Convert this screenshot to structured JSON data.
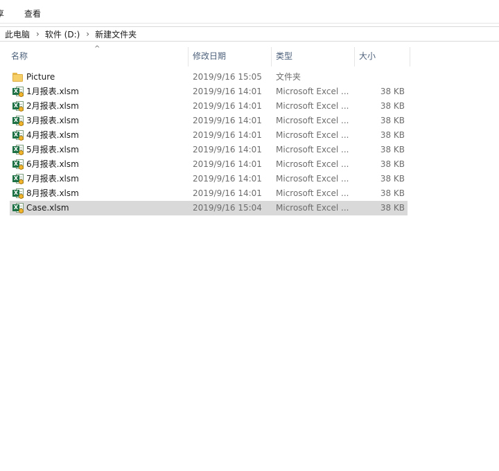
{
  "ribbon": {
    "tabs": [
      "享",
      "查看"
    ]
  },
  "address": {
    "crumbs": [
      "此电脑",
      "软件 (D:)",
      "新建文件夹"
    ],
    "separator": "›"
  },
  "columns": {
    "name": "名称",
    "date": "修改日期",
    "type": "类型",
    "size": "大小",
    "sort_indicator": "^"
  },
  "files": [
    {
      "icon": "folder-icon",
      "name": "Picture",
      "date": "2019/9/16 15:05",
      "type": "文件夹",
      "size": ""
    },
    {
      "icon": "excel-macro-icon",
      "name": "1月报表.xlsm",
      "date": "2019/9/16 14:01",
      "type": "Microsoft Excel ...",
      "size": "38 KB"
    },
    {
      "icon": "excel-macro-icon",
      "name": "2月报表.xlsm",
      "date": "2019/9/16 14:01",
      "type": "Microsoft Excel ...",
      "size": "38 KB"
    },
    {
      "icon": "excel-macro-icon",
      "name": "3月报表.xlsm",
      "date": "2019/9/16 14:01",
      "type": "Microsoft Excel ...",
      "size": "38 KB"
    },
    {
      "icon": "excel-macro-icon",
      "name": "4月报表.xlsm",
      "date": "2019/9/16 14:01",
      "type": "Microsoft Excel ...",
      "size": "38 KB"
    },
    {
      "icon": "excel-macro-icon",
      "name": "5月报表.xlsm",
      "date": "2019/9/16 14:01",
      "type": "Microsoft Excel ...",
      "size": "38 KB"
    },
    {
      "icon": "excel-macro-icon",
      "name": "6月报表.xlsm",
      "date": "2019/9/16 14:01",
      "type": "Microsoft Excel ...",
      "size": "38 KB"
    },
    {
      "icon": "excel-macro-icon",
      "name": "7月报表.xlsm",
      "date": "2019/9/16 14:01",
      "type": "Microsoft Excel ...",
      "size": "38 KB"
    },
    {
      "icon": "excel-macro-icon",
      "name": "8月报表.xlsm",
      "date": "2019/9/16 14:01",
      "type": "Microsoft Excel ...",
      "size": "38 KB"
    },
    {
      "icon": "excel-macro-icon",
      "name": "Case.xlsm",
      "date": "2019/9/16 15:04",
      "type": "Microsoft Excel ...",
      "size": "38 KB",
      "selected": true
    }
  ],
  "colors": {
    "selection": "#d9d9d9",
    "header_text": "#4c607a",
    "excel_green": "#1d7144",
    "folder": "#f6cf68"
  }
}
